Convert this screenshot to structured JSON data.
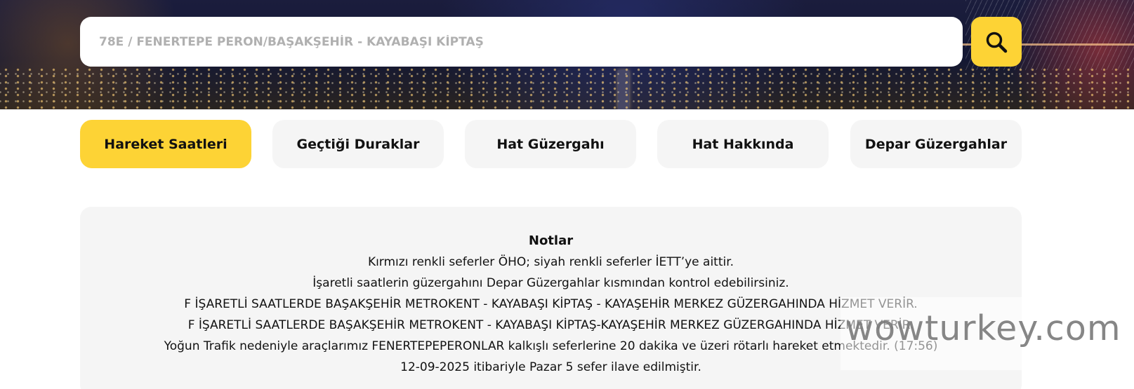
{
  "search": {
    "value": "78E / FENERTEPE PERON/BAŞAKŞEHİR - KAYABAŞI KİPTAŞ",
    "button_icon": "search-icon"
  },
  "tabs": [
    {
      "label": "Hareket Saatleri",
      "active": true
    },
    {
      "label": "Geçtiği Duraklar",
      "active": false
    },
    {
      "label": "Hat Güzergahı",
      "active": false
    },
    {
      "label": "Hat Hakkında",
      "active": false
    },
    {
      "label": "Depar Güzergahlar",
      "active": false
    }
  ],
  "notes": {
    "title": "Notlar",
    "lines": [
      "Kırmızı renkli seferler ÖHO; siyah renkli seferler İETT’ye aittir.",
      "İşaretli saatlerin güzergahını Depar Güzergahlar kısmından kontrol edebilirsiniz.",
      "F İŞARETLİ SAATLERDE BAŞAKŞEHİR METROKENT - KAYABAŞI KİPTAŞ - KAYAŞEHİR MERKEZ GÜZERGAHINDA HİZMET VERİR.",
      "F İŞARETLİ SAATLERDE BAŞAKŞEHİR METROKENT - KAYABAŞI KİPTAŞ-KAYAŞEHİR MERKEZ GÜZERGAHINDA HİZMET VERİR.",
      "Yoğun Trafik nedeniyle araçlarımız FENERTEPEPERONLAR kalkışlı seferlerine 20 dakika ve üzeri rötarlı hareket etmektedir. (17:56)",
      "12-09-2025 itibariyle Pazar 5 sefer ilave edilmiştir."
    ]
  },
  "watermark": "wowturkey.com",
  "colors": {
    "accent": "#fdd335",
    "tab_bg": "#f5f5f5",
    "notes_bg": "#f5f5f5",
    "text": "#111111",
    "placeholder": "#b0b0b0"
  }
}
